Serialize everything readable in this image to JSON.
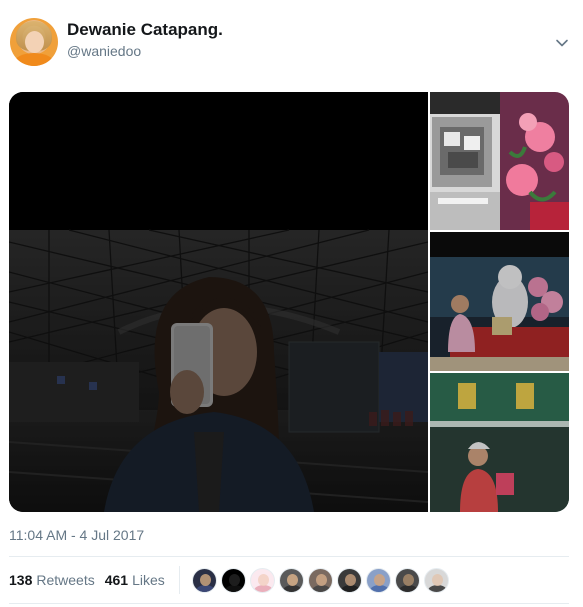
{
  "tweet": {
    "author_name": "Dewanie Catapang.",
    "author_handle": "@waniedoo",
    "timestamp": "11:04 AM - 4 Jul 2017",
    "retweets_count": "138",
    "retweets_label": "Retweets",
    "likes_count": "461",
    "likes_label": "Likes"
  },
  "icons": {
    "more_menu": "chevron-down-icon"
  },
  "colors": {
    "text_primary": "#14171a",
    "text_secondary": "#657786",
    "divider": "#e6ecf0"
  },
  "likers": [
    {
      "face": "#c9a27c",
      "body": "#3d4a7a",
      "bg": "#2a2f45"
    },
    {
      "face": "#222222",
      "body": "#111111",
      "bg": "#000000"
    },
    {
      "face": "#f2d0c2",
      "body": "#e8a8b5",
      "bg": "#fbe9ef"
    },
    {
      "face": "#d8b08a",
      "body": "#2f2f2f",
      "bg": "#5a5a5a"
    },
    {
      "face": "#cfa887",
      "body": "#444444",
      "bg": "#7a6a60"
    },
    {
      "face": "#bf9a7a",
      "body": "#1e1e1e",
      "bg": "#3a3a3a"
    },
    {
      "face": "#d0a37e",
      "body": "#4b6aa8",
      "bg": "#8aa0c8"
    },
    {
      "face": "#a88a6a",
      "body": "#2a2a2a",
      "bg": "#4a4a4a"
    },
    {
      "face": "#e2c6b0",
      "body": "#3a3a3a",
      "bg": "#d8d8d8"
    }
  ]
}
